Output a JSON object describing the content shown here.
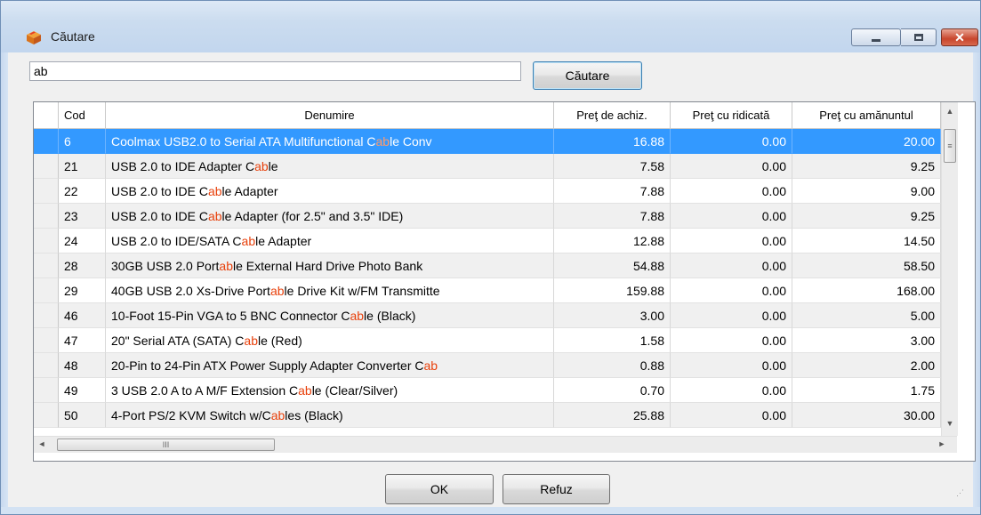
{
  "window": {
    "title": "Căutare",
    "icon": "box-icon",
    "controls": {
      "minimize": "minimize-icon",
      "maximize": "maximize-icon",
      "close": "✕"
    }
  },
  "search": {
    "value": "ab",
    "button_label": "Căutare"
  },
  "table": {
    "columns": [
      "Cod",
      "Denumire",
      "Preţ de achiz.",
      "Preţ cu ridicată",
      "Preţ cu amănuntul"
    ],
    "selected_row": 0,
    "rows": [
      {
        "cod": "6",
        "den": [
          "Coolmax USB2.0 to Serial ATA Multifunctional C",
          "ab",
          "le Conv"
        ],
        "achiz": "16.88",
        "ridicata": "0.00",
        "amanunt": "20.00"
      },
      {
        "cod": "21",
        "den": [
          "USB 2.0 to IDE Adapter C",
          "ab",
          "le"
        ],
        "achiz": "7.58",
        "ridicata": "0.00",
        "amanunt": "9.25"
      },
      {
        "cod": "22",
        "den": [
          "USB 2.0 to IDE C",
          "ab",
          "le Adapter"
        ],
        "achiz": "7.88",
        "ridicata": "0.00",
        "amanunt": "9.00"
      },
      {
        "cod": "23",
        "den": [
          "USB 2.0 to IDE C",
          "ab",
          "le Adapter (for 2.5\" and 3.5\" IDE)"
        ],
        "achiz": "7.88",
        "ridicata": "0.00",
        "amanunt": "9.25"
      },
      {
        "cod": "24",
        "den": [
          "USB 2.0 to IDE/SATA C",
          "ab",
          "le Adapter"
        ],
        "achiz": "12.88",
        "ridicata": "0.00",
        "amanunt": "14.50"
      },
      {
        "cod": "28",
        "den": [
          "30GB USB 2.0 Port",
          "ab",
          "le External Hard Drive  Photo Bank"
        ],
        "achiz": "54.88",
        "ridicata": "0.00",
        "amanunt": "58.50"
      },
      {
        "cod": "29",
        "den": [
          "40GB USB 2.0 Xs-Drive Port",
          "ab",
          "le Drive Kit w/FM Transmitte"
        ],
        "achiz": "159.88",
        "ridicata": "0.00",
        "amanunt": "168.00"
      },
      {
        "cod": "46",
        "den": [
          "10-Foot 15-Pin VGA to 5 BNC Connector C",
          "ab",
          "le (Black)"
        ],
        "achiz": "3.00",
        "ridicata": "0.00",
        "amanunt": "5.00"
      },
      {
        "cod": "47",
        "den": [
          "20\" Serial ATA (SATA) C",
          "ab",
          "le (Red)"
        ],
        "achiz": "1.58",
        "ridicata": "0.00",
        "amanunt": "3.00"
      },
      {
        "cod": "48",
        "den": [
          "20-Pin to 24-Pin ATX Power Supply Adapter Converter C",
          "ab",
          ""
        ],
        "achiz": "0.88",
        "ridicata": "0.00",
        "amanunt": "2.00"
      },
      {
        "cod": "49",
        "den": [
          "3 USB 2.0 A to A M/F Extension C",
          "ab",
          "le (Clear/Silver)"
        ],
        "achiz": "0.70",
        "ridicata": "0.00",
        "amanunt": "1.75"
      },
      {
        "cod": "50",
        "den": [
          "4-Port PS/2 KVM Switch w/C",
          "ab",
          "les (Black)"
        ],
        "achiz": "25.88",
        "ridicata": "0.00",
        "amanunt": "30.00"
      }
    ]
  },
  "footer": {
    "ok_label": "OK",
    "cancel_label": "Refuz"
  },
  "scroll_glyphs": {
    "up": "▲",
    "down": "▼",
    "left": "◄",
    "right": "►",
    "vgrip": "≡",
    "hgrip": "III"
  },
  "colors": {
    "selection": "#3399ff",
    "highlight": "#e8410c",
    "close_button": "#c8452c"
  }
}
